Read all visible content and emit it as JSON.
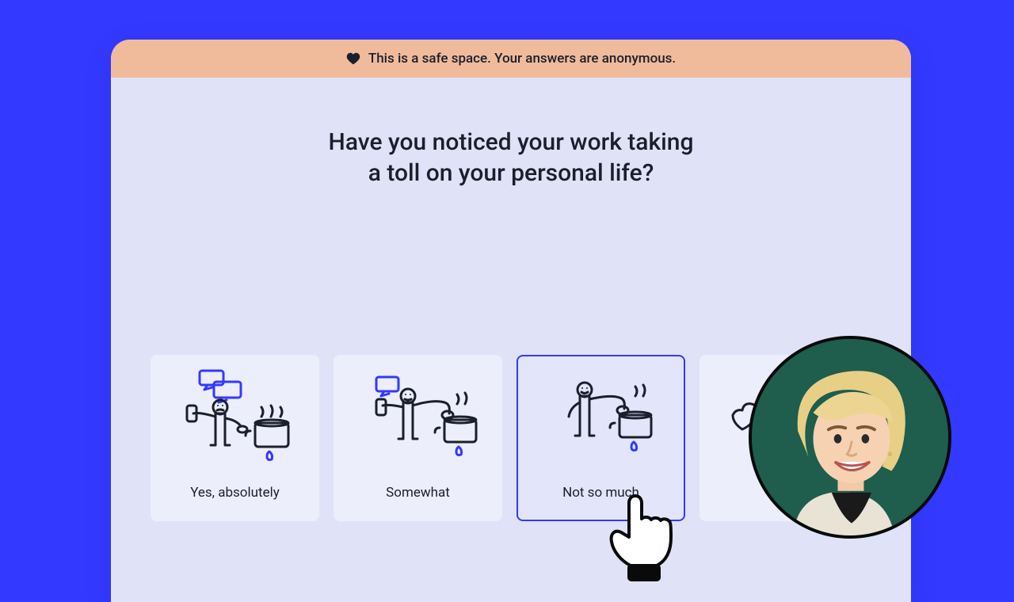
{
  "banner": {
    "text": "This is a safe space. Your answers are anonymous."
  },
  "question": {
    "text": "Have you noticed your work taking\na toll on your personal life?"
  },
  "options": [
    {
      "label": "Yes, absolutely",
      "icon": "stress-high-icon",
      "selected": false
    },
    {
      "label": "Somewhat",
      "icon": "stress-mid-icon",
      "selected": false
    },
    {
      "label": "Not so much",
      "icon": "stress-low-icon",
      "selected": true
    },
    {
      "label": "",
      "icon": "stress-none-icon",
      "selected": false
    }
  ],
  "colors": {
    "background": "#3339ff",
    "window": "#e0e3f7",
    "banner": "#f0bb9a",
    "card": "#eceefb",
    "accent": "#3339ff"
  }
}
